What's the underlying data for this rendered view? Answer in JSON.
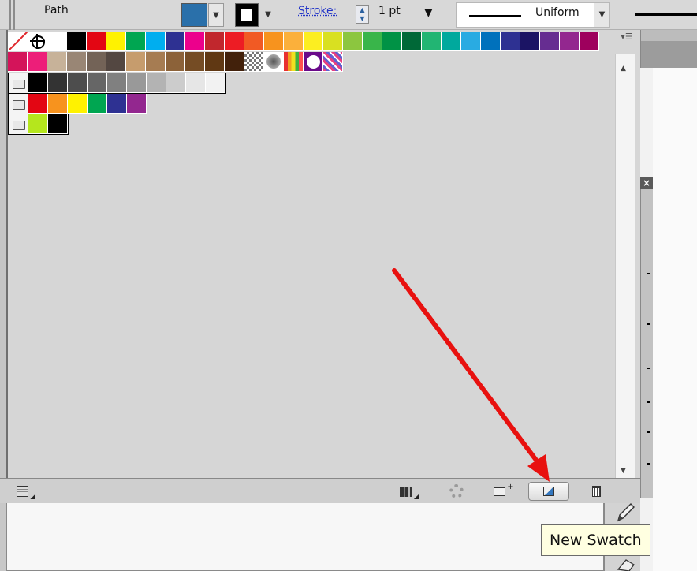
{
  "control_bar": {
    "selection_label": "Path",
    "fill_color": "#2a70aa",
    "stroke_link_label": "Stroke:",
    "stroke_weight": "1 pt",
    "variable_width_profile": "Uniform"
  },
  "swatches_panel": {
    "rows": [
      [
        "none",
        "registration",
        "#ffffff",
        "#000000",
        "#e30613",
        "#fff200",
        "#00a651",
        "#00aeef",
        "#2e3192",
        "#ec008c",
        "#c1272d",
        "#ed1c24",
        "#f15a24",
        "#f7931e",
        "#fbb03b",
        "#fcee21",
        "#d9e021",
        "#8cc63f",
        "#39b54a",
        "#009245",
        "#006837",
        "#22b573",
        "#00a99d",
        "#29abe2",
        "#0071bc",
        "#2e3192",
        "#1b1464",
        "#662d91",
        "#93278f",
        "#9e005d"
      ],
      [
        "#d4145a",
        "#ed1e79",
        "#c7b299",
        "#998675",
        "#736357",
        "#534741",
        "#c69c6d",
        "#a67c52",
        "#8c6239",
        "#754c24",
        "#603813",
        "#42210b",
        "pattern-check",
        "pattern-dot",
        "pattern-stripes",
        "pattern-circle",
        "pattern-diag"
      ],
      [
        "folder",
        "#000000",
        "#333333",
        "#4d4d4d",
        "#666666",
        "#808080",
        "#999999",
        "#b3b3b3",
        "#cccccc",
        "#e6e6e6",
        "#f2f2f2"
      ],
      [
        "folder",
        "#e30613",
        "#f7931e",
        "#fff200",
        "#00a651",
        "#2e3192",
        "#93278f"
      ],
      [
        "folder",
        "#b5e61d",
        "#000000"
      ]
    ]
  },
  "tooltip": {
    "text": "New Swatch"
  },
  "colors": {
    "annotation_arrow": "#e8110f"
  }
}
